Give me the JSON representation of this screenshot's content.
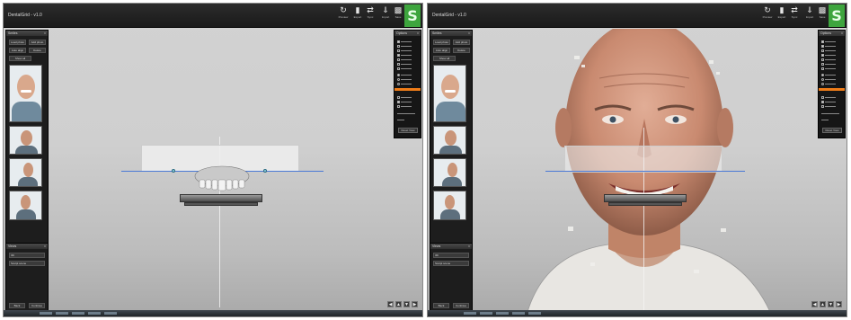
{
  "screens": [
    {
      "title": "DentalGrid - v1.0",
      "view": "dentition-only",
      "toolbar": [
        {
          "label": "Preview",
          "icon": "refresh-icon"
        },
        {
          "label": "Export",
          "icon": "document-icon"
        },
        {
          "label": "Sync",
          "icon": "sync-icon"
        },
        {
          "label": "Import",
          "icon": "import-icon"
        },
        {
          "label": "Save",
          "icon": "save-icon"
        },
        {
          "label": "Quit",
          "icon": "close-icon"
        }
      ],
      "logo": "S",
      "left_panel": {
        "header": "Smiles",
        "buttons": [
          "Load photo",
          "Add photo",
          "Auto align",
          "Delete",
          "Show all"
        ],
        "photos": [
          "frontal-smile",
          "frontal-rest",
          "profile-right",
          "profile-left"
        ],
        "lower_header": "Views",
        "lower_items": [
          "3D",
          "Sculpt scene"
        ],
        "footer_buttons": [
          "Back",
          "Continue"
        ]
      },
      "options_panel": {
        "header": "Options",
        "items": [
          "Show Dentition",
          "Show Face scan",
          "Show Photo",
          "Show Planes",
          "Show Guidelines",
          "Show Ruler",
          "Lock View"
        ],
        "radios": [
          "Occlusal plane",
          "Midline",
          "Smile line"
        ],
        "checks": [
          "Show Landmarks",
          "Show Bite",
          "Show Measures"
        ],
        "opacity_label": "Opacity 50",
        "button": "Reset View"
      },
      "nav_icons": [
        "nav-left-icon",
        "nav-up-icon",
        "nav-down-icon",
        "nav-right-icon"
      ]
    },
    {
      "title": "DentalGrid - v1.0",
      "view": "face-overlay",
      "toolbar": [
        {
          "label": "Preview",
          "icon": "refresh-icon"
        },
        {
          "label": "Export",
          "icon": "document-icon"
        },
        {
          "label": "Sync",
          "icon": "sync-icon"
        },
        {
          "label": "Import",
          "icon": "import-icon"
        },
        {
          "label": "Save",
          "icon": "save-icon"
        },
        {
          "label": "Quit",
          "icon": "close-icon"
        }
      ],
      "logo": "S",
      "left_panel": {
        "header": "Smiles",
        "buttons": [
          "Load photo",
          "Add photo",
          "Auto align",
          "Delete",
          "Show all"
        ],
        "photos": [
          "frontal-smile",
          "frontal-rest",
          "profile-right",
          "profile-left"
        ],
        "lower_header": "Views",
        "lower_items": [
          "3D",
          "Sculpt scene"
        ],
        "footer_buttons": [
          "Back",
          "Continue"
        ]
      },
      "options_panel": {
        "header": "Options",
        "items": [
          "Show Dentition",
          "Show Face scan",
          "Show Photo",
          "Show Planes",
          "Show Guidelines",
          "Show Ruler",
          "Lock View"
        ],
        "radios": [
          "Occlusal plane",
          "Midline",
          "Smile line"
        ],
        "checks": [
          "Show Landmarks",
          "Show Bite",
          "Show Measures"
        ],
        "opacity_label": "Opacity 50",
        "button": "Reset View"
      },
      "nav_icons": [
        "nav-left-icon",
        "nav-up-icon",
        "nav-down-icon",
        "nav-right-icon"
      ]
    }
  ],
  "colors": {
    "accent_orange": "#f07d18",
    "logo_green": "#3ea53e",
    "plane_blue": "#4b79d6",
    "background_gray": "#cfcfcf"
  }
}
